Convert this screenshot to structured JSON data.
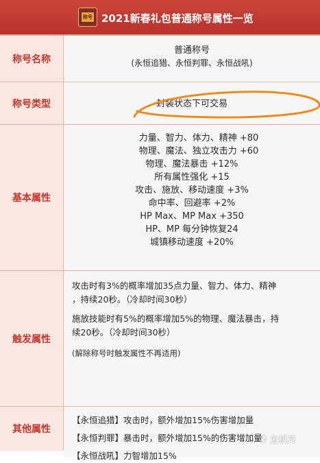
{
  "header": {
    "title": "2021新春礼包普通称号属性一览",
    "logo_text": "称号"
  },
  "rows": {
    "title_name": {
      "label": "称号名称",
      "lines": [
        "普通称号",
        "(永恒追猎、永恒判罪、永恒战吼)"
      ]
    },
    "title_type": {
      "label": "称号类型",
      "value": "封装状态下可交易"
    },
    "basic": {
      "label": "基本属性",
      "lines": [
        "力量、智力、体力、精神 +80",
        "物理、魔法、独立攻击力 +60",
        "物理、魔法暴击 +12%",
        "所有属性强化 +15",
        "攻击、施放、移动速度 +3%",
        "命中率、回避率 +2%",
        "HP Max、MP Max +350",
        "HP、MP 每分钟恢复24",
        "城镇移动速度 +20%"
      ]
    },
    "trigger": {
      "label": "触发属性",
      "p1a": "攻击时有3%的概率增加35点力量、智力、体力、精神",
      "p1b": "，持续20秒。（冷却时间30秒）",
      "p2a": "施放技能时有5%的概率增加5%的物理、魔法暴击，持",
      "p2b": "续20秒。（冷却时间30秒）",
      "note": "(解除称号时触发属性不再适用)"
    },
    "other": {
      "label": "其他属性",
      "lines": [
        "【永恒追猎】攻击时，额外增加15%伤害增加量",
        "【永恒判罪】暴击时，额外增加15%的伤害增加量",
        "【永恒战吼】力智增加15%"
      ]
    }
  },
  "annotation": {
    "color": "#f08a1c"
  },
  "watermark": {
    "text": "主机方"
  }
}
